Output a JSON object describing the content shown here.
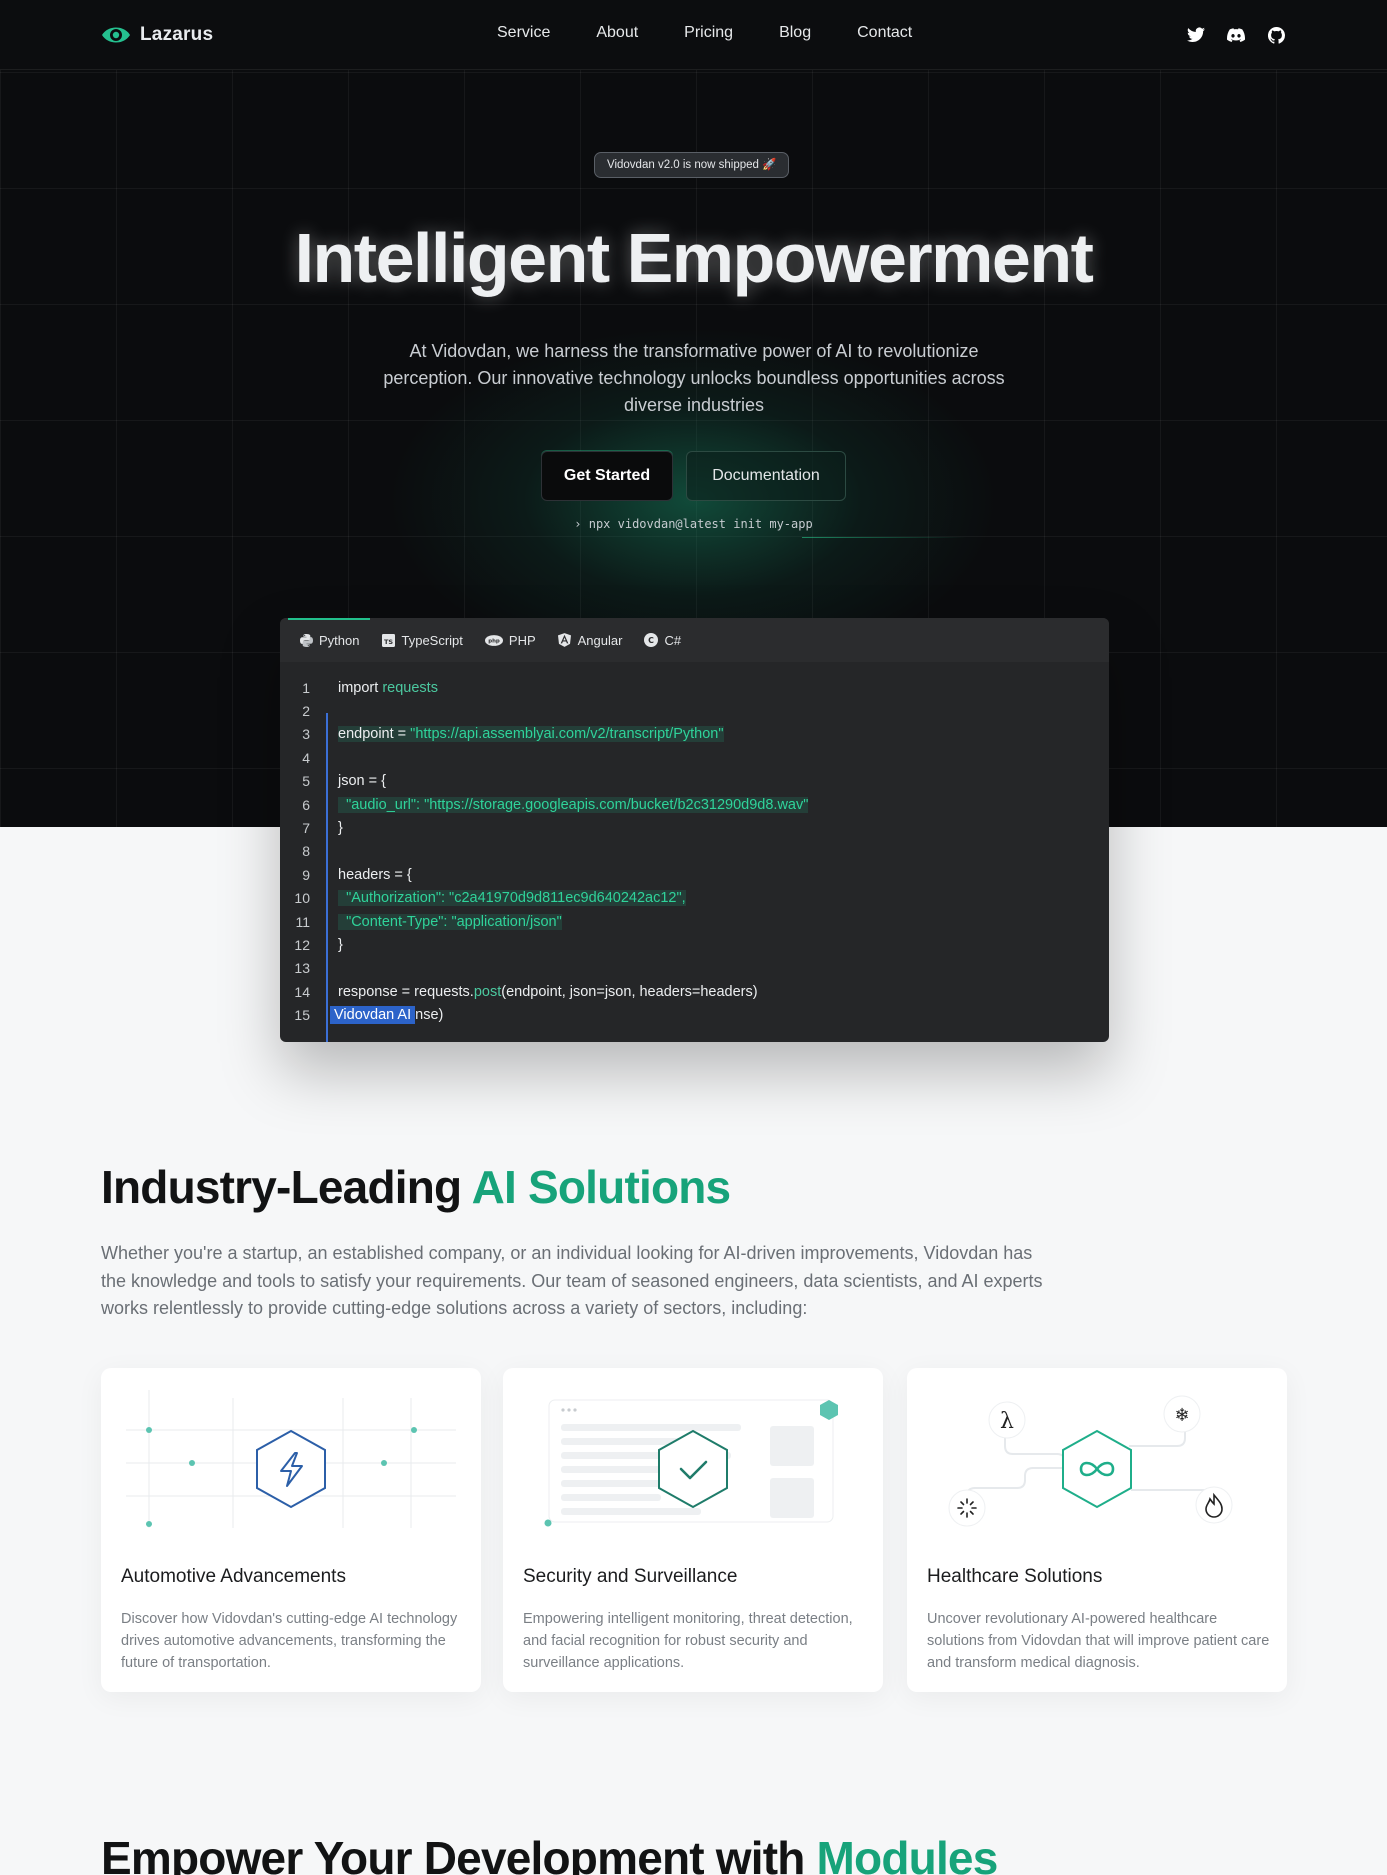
{
  "brand": {
    "name": "Lazarus"
  },
  "nav": {
    "items": [
      "Service",
      "About",
      "Pricing",
      "Blog",
      "Contact"
    ]
  },
  "socials": [
    "twitter-icon",
    "discord-icon",
    "github-icon"
  ],
  "hero": {
    "badge": "Vidovdan v2.0 is now shipped 🚀",
    "title": "Intelligent Empowerment",
    "subtitle": "At Vidovdan, we harness the transformative power of AI to revolutionize perception. Our innovative technology unlocks boundless opportunities across diverse industries",
    "primary_button": "Get Started",
    "secondary_button": "Documentation",
    "cli_command": "› npx vidovdan@latest init my-app"
  },
  "code": {
    "tabs": [
      {
        "label": "Python",
        "icon": "python-icon",
        "active": true
      },
      {
        "label": "TypeScript",
        "icon": "typescript-icon",
        "active": false
      },
      {
        "label": "PHP",
        "icon": "php-icon",
        "active": false
      },
      {
        "label": "Angular",
        "icon": "angular-icon",
        "active": false
      },
      {
        "label": "C#",
        "icon": "csharp-icon",
        "active": false
      }
    ],
    "lines": [
      {
        "n": "1",
        "parts": [
          [
            "import ",
            "t"
          ],
          [
            "requests",
            "fn"
          ]
        ]
      },
      {
        "n": "2",
        "parts": []
      },
      {
        "n": "3",
        "parts": [
          [
            "endpoint = ",
            "t"
          ],
          [
            "\"https://api.assemblyai.com/v2/transcript/Python\"",
            "str"
          ]
        ],
        "hl": true
      },
      {
        "n": "4",
        "parts": []
      },
      {
        "n": "5",
        "parts": [
          [
            "json = {",
            "t"
          ]
        ]
      },
      {
        "n": "6",
        "parts": [
          [
            "  ",
            "t"
          ],
          [
            "\"audio_url\": \"https://storage.googleapis.com/bucket/b2c31290d9d8.wav\"",
            "str"
          ]
        ],
        "hl": true
      },
      {
        "n": "7",
        "parts": [
          [
            "}",
            "t"
          ]
        ]
      },
      {
        "n": "8",
        "parts": []
      },
      {
        "n": "9",
        "parts": [
          [
            "headers = {",
            "t"
          ]
        ]
      },
      {
        "n": "10",
        "parts": [
          [
            "  ",
            "t"
          ],
          [
            "\"Authorization\": \"c2a41970d9d811ec9d640242ac12\",",
            "str"
          ]
        ],
        "hl": true
      },
      {
        "n": "11",
        "parts": [
          [
            "  ",
            "t"
          ],
          [
            "\"Content-Type\": \"application/json\"",
            "str"
          ]
        ],
        "hl": true
      },
      {
        "n": "12",
        "parts": [
          [
            "}",
            "t"
          ]
        ]
      },
      {
        "n": "13",
        "parts": []
      },
      {
        "n": "14",
        "parts": [
          [
            "response = requests.",
            "t"
          ],
          [
            "post",
            "fn"
          ],
          [
            "(endpoint, json=json, headers=headers)",
            "t"
          ]
        ]
      },
      {
        "n": "15",
        "parts": [
          [
            "Vidovdan AI",
            "sel"
          ],
          [
            "nse)",
            "t"
          ]
        ]
      }
    ]
  },
  "solutions": {
    "title_main": "Industry-Leading ",
    "title_accent": "AI Solutions",
    "description": "Whether you're a startup, an established company, or an individual looking for AI-driven improvements, Vidovdan has the knowledge and tools to satisfy your requirements. Our team of seasoned engineers, data scientists, and AI experts works relentlessly to provide cutting-edge solutions across a variety of sectors, including:",
    "cards": [
      {
        "title": "Automotive Advancements",
        "desc": "Discover how Vidovdan's cutting-edge AI technology drives automotive advancements, transforming the future of transportation.",
        "icon": "lightning-icon"
      },
      {
        "title": "Security and Surveillance",
        "desc": "Empowering intelligent monitoring, threat detection, and facial recognition for robust security and surveillance applications.",
        "icon": "checkmark-icon"
      },
      {
        "title": "Healthcare Solutions",
        "desc": "Uncover revolutionary AI-powered healthcare solutions from Vidovdan that will improve patient care and transform medical diagnosis.",
        "icon": "infinity-icon"
      }
    ]
  },
  "modules": {
    "title_main": "Empower Your Development with ",
    "title_accent": "Modules"
  },
  "colors": {
    "accent": "#17a37a",
    "hero_bg": "#0b0c0e",
    "code_bg": "#252628",
    "selection": "#2c63c9"
  }
}
